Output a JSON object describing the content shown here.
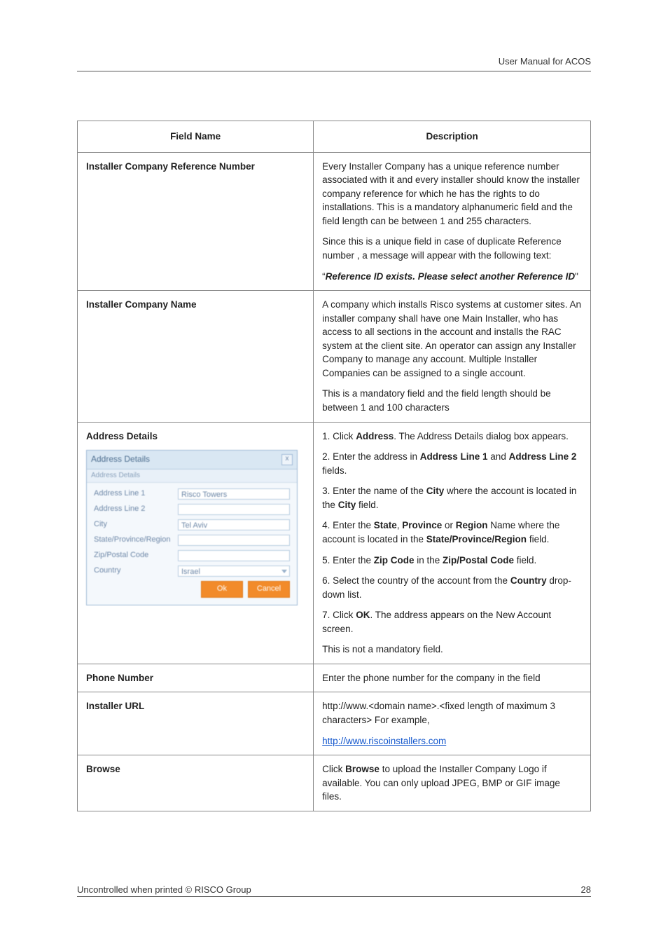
{
  "header": {
    "running_head": "User Manual for ACOS"
  },
  "table": {
    "head": {
      "field": "Field Name",
      "desc": "Description"
    },
    "rows": {
      "ref_num": {
        "field": "Installer Company Reference Number",
        "p1": "Every Installer Company has a unique reference number associated with it and every installer should know the installer company reference for which he has the rights to do installations. This is a mandatory alphanumeric field and the field length can be between 1 and 255 characters.",
        "p2": "Since this is a unique field in case of duplicate Reference number , a message will appear with the following text:",
        "p3_pre": "“",
        "p3_msg": "Reference ID exists. Please select another Reference ID",
        "p3_post": "\""
      },
      "comp_name": {
        "field": "Installer Company Name",
        "p1": "A company which installs Risco systems at customer sites. An installer company shall have one Main Installer, who has access to all sections in the account and installs the RAC system at the client site. An operator can assign any Installer Company to manage any account. Multiple Installer Companies can be assigned to a single account.",
        "p2": "This is a mandatory field and the field length should be between 1 and 100 characters"
      },
      "address": {
        "field": "Address Details",
        "l1a": "1. Click ",
        "l1b": "Address",
        "l1c": ". The Address Details dialog box appears.",
        "l2a": "2. Enter the address in ",
        "l2b": "Address Line 1",
        "l2c": " and ",
        "l2d": "Address Line 2",
        "l2e": " fields.",
        "l3a": "3. Enter the name of the ",
        "l3b": "City",
        "l3c": " where the account is located in the ",
        "l3d": "City",
        "l3e": " field.",
        "l4a": "4. Enter the ",
        "l4b": "State",
        "l4c": ", ",
        "l4d": "Province",
        "l4e": " or ",
        "l4f": "Region",
        "l4g": " Name where the account is located in the ",
        "l4h": "State/Province/Region",
        "l4i": " field.",
        "l5a": "5. Enter the ",
        "l5b": "Zip Code",
        "l5c": " in the ",
        "l5d": "Zip/Postal Code",
        "l5e": " field.",
        "l6a": "6. Select the country of the account from the ",
        "l6b": "Country",
        "l6c": " drop-down list.",
        "l7a": "7. Click ",
        "l7b": "OK",
        "l7c": ". The address appears on the New Account screen.",
        "l8": "This is not a mandatory field."
      },
      "phone": {
        "field": "Phone Number",
        "p1": "Enter the phone number for the company in the field"
      },
      "url": {
        "field": "Installer URL",
        "p1": "http://www.<domain name>.<fixed length of maximum 3 characters> For example,",
        "link": "http://www.riscoinstallers.com"
      },
      "browse": {
        "field": "Browse",
        "p1a": "Click ",
        "p1b": "Browse",
        "p1c": " to upload the Installer Company Logo if available. You can only upload JPEG, BMP or GIF image files."
      }
    }
  },
  "dialog": {
    "title": "Address Details",
    "subhead": "Address Details",
    "labels": {
      "line1": "Address Line 1",
      "line2": "Address Line 2",
      "city": "City",
      "region": "State/Province/Region",
      "zip": "Zip/Postal Code",
      "country": "Country"
    },
    "values": {
      "line1": "Risco Towers",
      "city": "Tel Aviv",
      "country": "Israel"
    },
    "buttons": {
      "ok": "Ok",
      "cancel": "Cancel"
    }
  },
  "footer": {
    "left": "Uncontrolled when printed © RISCO Group",
    "right": "28"
  }
}
